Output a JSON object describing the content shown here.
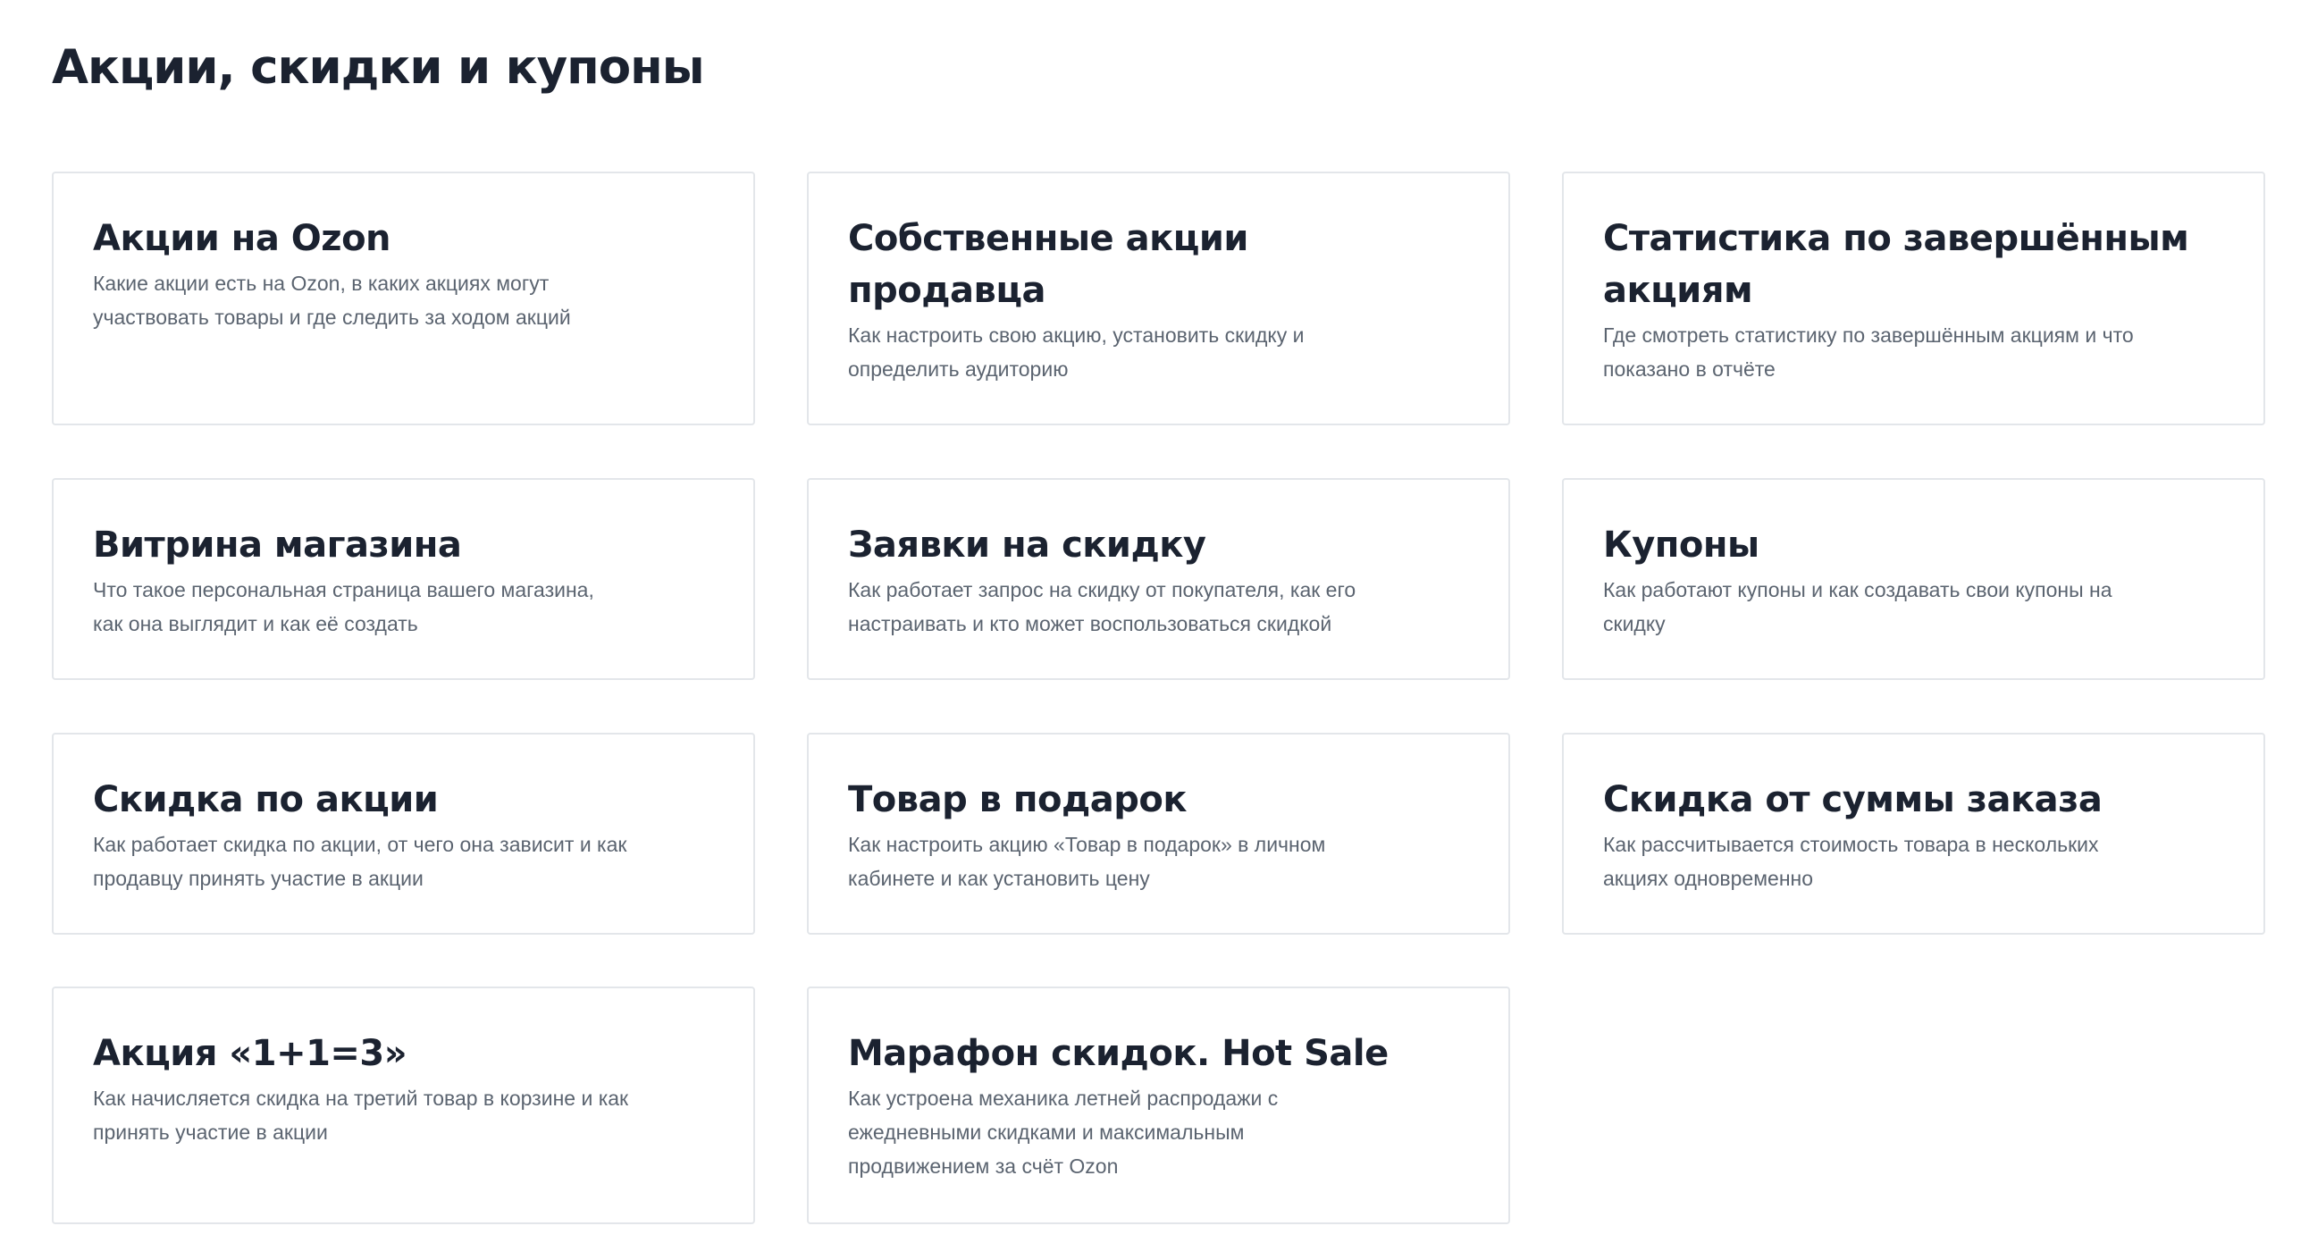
{
  "page": {
    "title": "Акции, скидки и купоны"
  },
  "cards": [
    {
      "title": "Акции на Ozon",
      "description": "Какие акции есть на Ozon, в каких акциях могут участвовать товары и где следить за ходом акций"
    },
    {
      "title": "Собственные акции продавца",
      "description": "Как настроить свою акцию, установить скидку и определить аудиторию"
    },
    {
      "title": "Статистика по завершённым акциям",
      "description": "Где смотреть статистику по завершённым акциям и что показано в отчёте"
    },
    {
      "title": "Витрина магазина",
      "description": "Что такое персональная страница вашего магазина, как она выглядит и как её создать"
    },
    {
      "title": "Заявки на скидку",
      "description": "Как работает запрос на скидку от покупателя, как его настраивать и кто может воспользоваться скидкой"
    },
    {
      "title": "Купоны",
      "description": "Как работают купоны и как создавать свои купоны на скидку"
    },
    {
      "title": "Скидка по акции",
      "description": "Как работает скидка по акции, от чего она зависит и как продавцу принять участие в акции"
    },
    {
      "title": "Товар в подарок",
      "description": "Как настроить акцию «Товар в подарок» в личном кабинете и как установить цену"
    },
    {
      "title": "Скидка от суммы заказа",
      "description": "Как рассчитывается стоимость товара в нескольких акциях одновременно"
    },
    {
      "title": "Акция «1+1=3»",
      "description": "Как начисляется скидка на третий товар в корзине и как принять участие в акции"
    },
    {
      "title": "Марафон скидок. Hot Sale",
      "description": "Как устроена механика летней распродажи с ежедневными скидками и максимальным продвижением за счёт Ozon"
    }
  ]
}
